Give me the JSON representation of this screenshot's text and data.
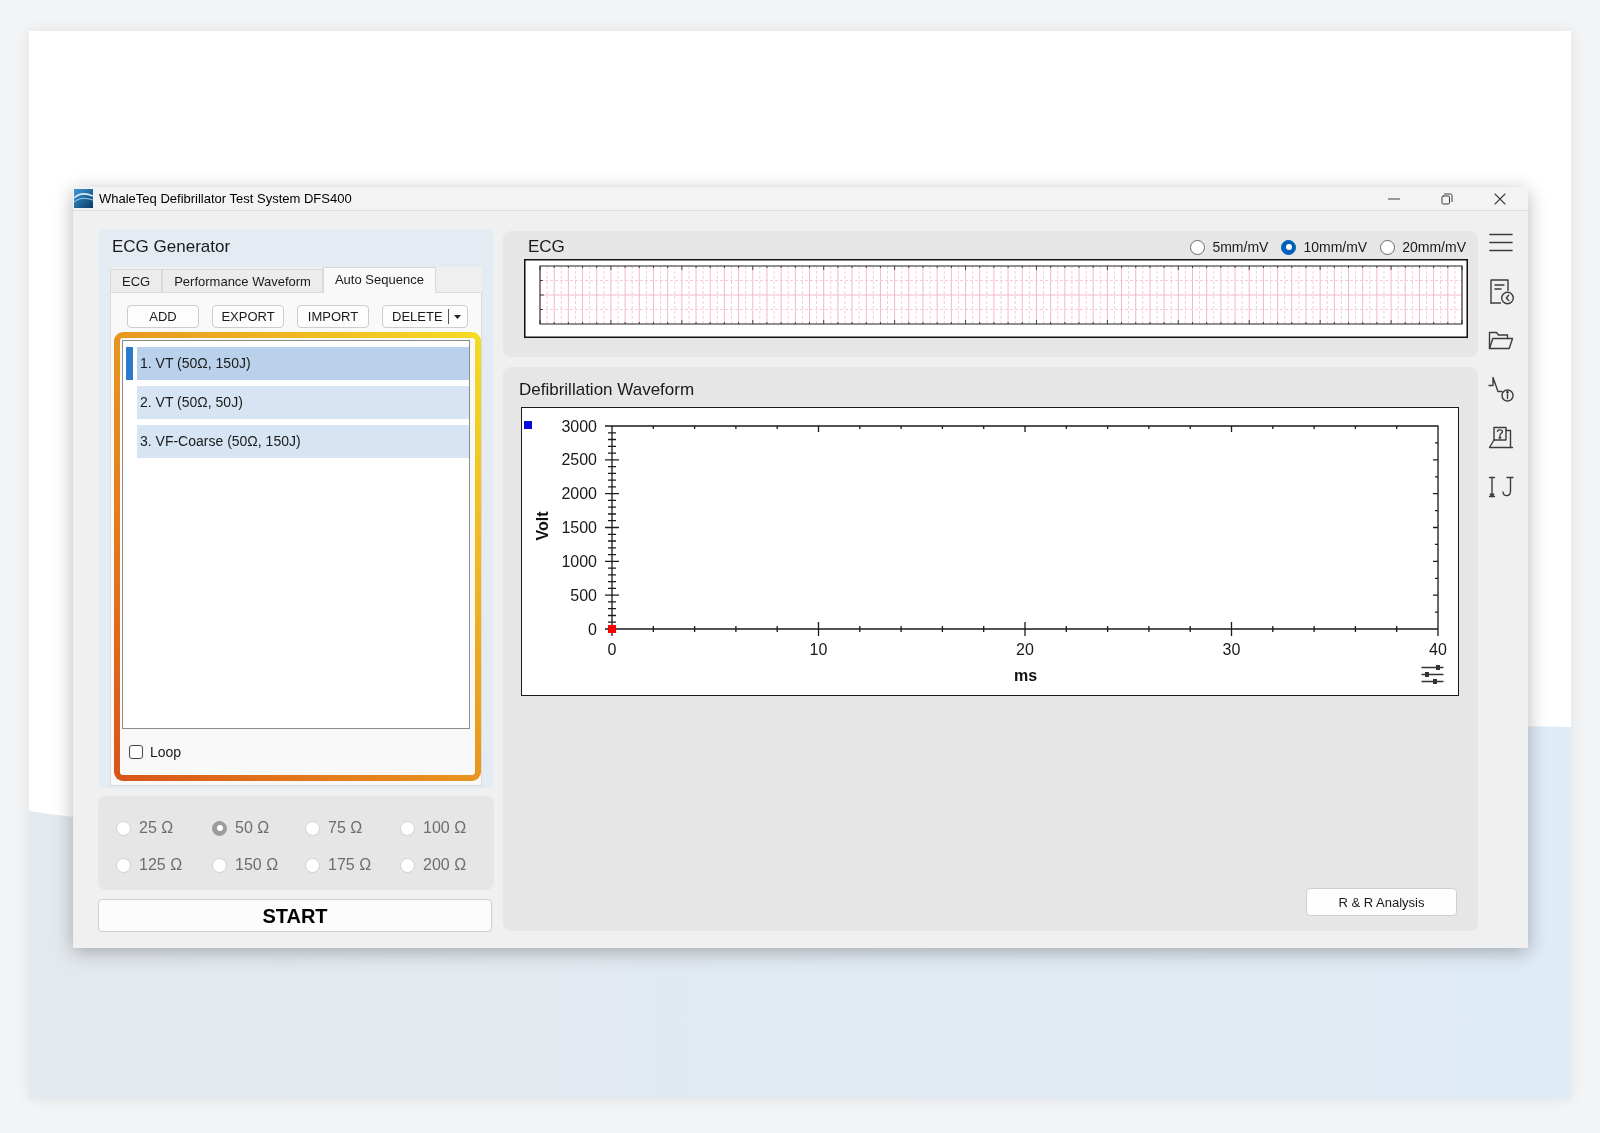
{
  "window": {
    "title": "WhaleTeq Defibrillator Test System DFS400"
  },
  "ecg_generator": {
    "title": "ECG Generator",
    "tabs": [
      {
        "label": "ECG",
        "selected": false
      },
      {
        "label": "Performance Waveform",
        "selected": false
      },
      {
        "label": "Auto Sequence",
        "selected": true
      }
    ],
    "buttons": [
      {
        "label": "ADD",
        "kind": "plain"
      },
      {
        "label": "EXPORT",
        "kind": "plain"
      },
      {
        "label": "IMPORT",
        "kind": "plain"
      },
      {
        "label": "DELETE",
        "kind": "split"
      }
    ],
    "sequence": [
      {
        "label": "1. VT (50Ω, 150J)",
        "selected": true
      },
      {
        "label": "2. VT (50Ω, 50J)",
        "selected": false
      },
      {
        "label": "3. VF-Coarse (50Ω, 150J)",
        "selected": false
      }
    ],
    "loop": {
      "label": "Loop",
      "checked": false
    }
  },
  "resistance": {
    "disabled": true,
    "options": [
      {
        "label": "25 Ω",
        "selected": false
      },
      {
        "label": "50 Ω",
        "selected": true
      },
      {
        "label": "75 Ω",
        "selected": false
      },
      {
        "label": "100 Ω",
        "selected": false
      },
      {
        "label": "125 Ω",
        "selected": false
      },
      {
        "label": "150 Ω",
        "selected": false
      },
      {
        "label": "175 Ω",
        "selected": false
      },
      {
        "label": "200 Ω",
        "selected": false
      }
    ]
  },
  "start_button": {
    "label": "START"
  },
  "ecg": {
    "title": "ECG",
    "scales": [
      {
        "label": "5mm/mV",
        "selected": false
      },
      {
        "label": "10mm/mV",
        "selected": true
      },
      {
        "label": "20mm/mV",
        "selected": false
      }
    ]
  },
  "defibrillation": {
    "title": "Defibrillation Waveform",
    "chart_data": {
      "type": "scatter",
      "xlabel": "ms",
      "ylabel": "Volt",
      "x": [
        0
      ],
      "series": [
        {
          "color": "#ff0000",
          "values": [
            0
          ]
        }
      ],
      "xlim": [
        0,
        40
      ],
      "ylim": [
        0,
        3000
      ],
      "xticks": [
        0,
        10,
        20,
        30,
        40
      ],
      "yticks": [
        0,
        500,
        1000,
        1500,
        2000,
        2500,
        3000
      ]
    },
    "button": {
      "label": "R & R Analysis"
    }
  }
}
